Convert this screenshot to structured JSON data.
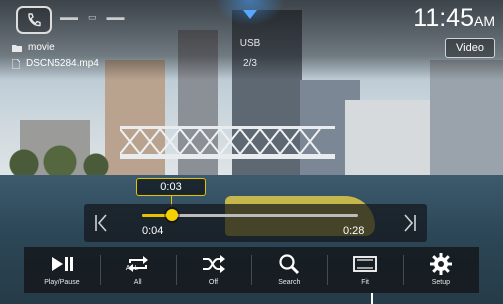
{
  "top_bar": {
    "folder_name": "movie",
    "file_name": "DSCN5284.mp4",
    "source": "USB",
    "track": "2/3",
    "clock": "11:45",
    "clock_suffix": "AM",
    "video_button": "Video"
  },
  "seek": {
    "tooltip_time": "0:03",
    "elapsed": "0:04",
    "total": "0:28",
    "progress": 0.14
  },
  "controls": [
    {
      "label": "Play/Pause",
      "icon": "play-pause-icon"
    },
    {
      "label": "All",
      "icon": "repeat-icon",
      "small_label": "ALL"
    },
    {
      "label": "Off",
      "icon": "shuffle-icon"
    },
    {
      "label": "Search",
      "icon": "search-icon"
    },
    {
      "label": "Fit",
      "icon": "aspect-fit-icon"
    },
    {
      "label": "Setup",
      "icon": "gear-icon"
    }
  ],
  "colors": {
    "accent": "#e7c200",
    "arrow": "#57a7ff"
  }
}
